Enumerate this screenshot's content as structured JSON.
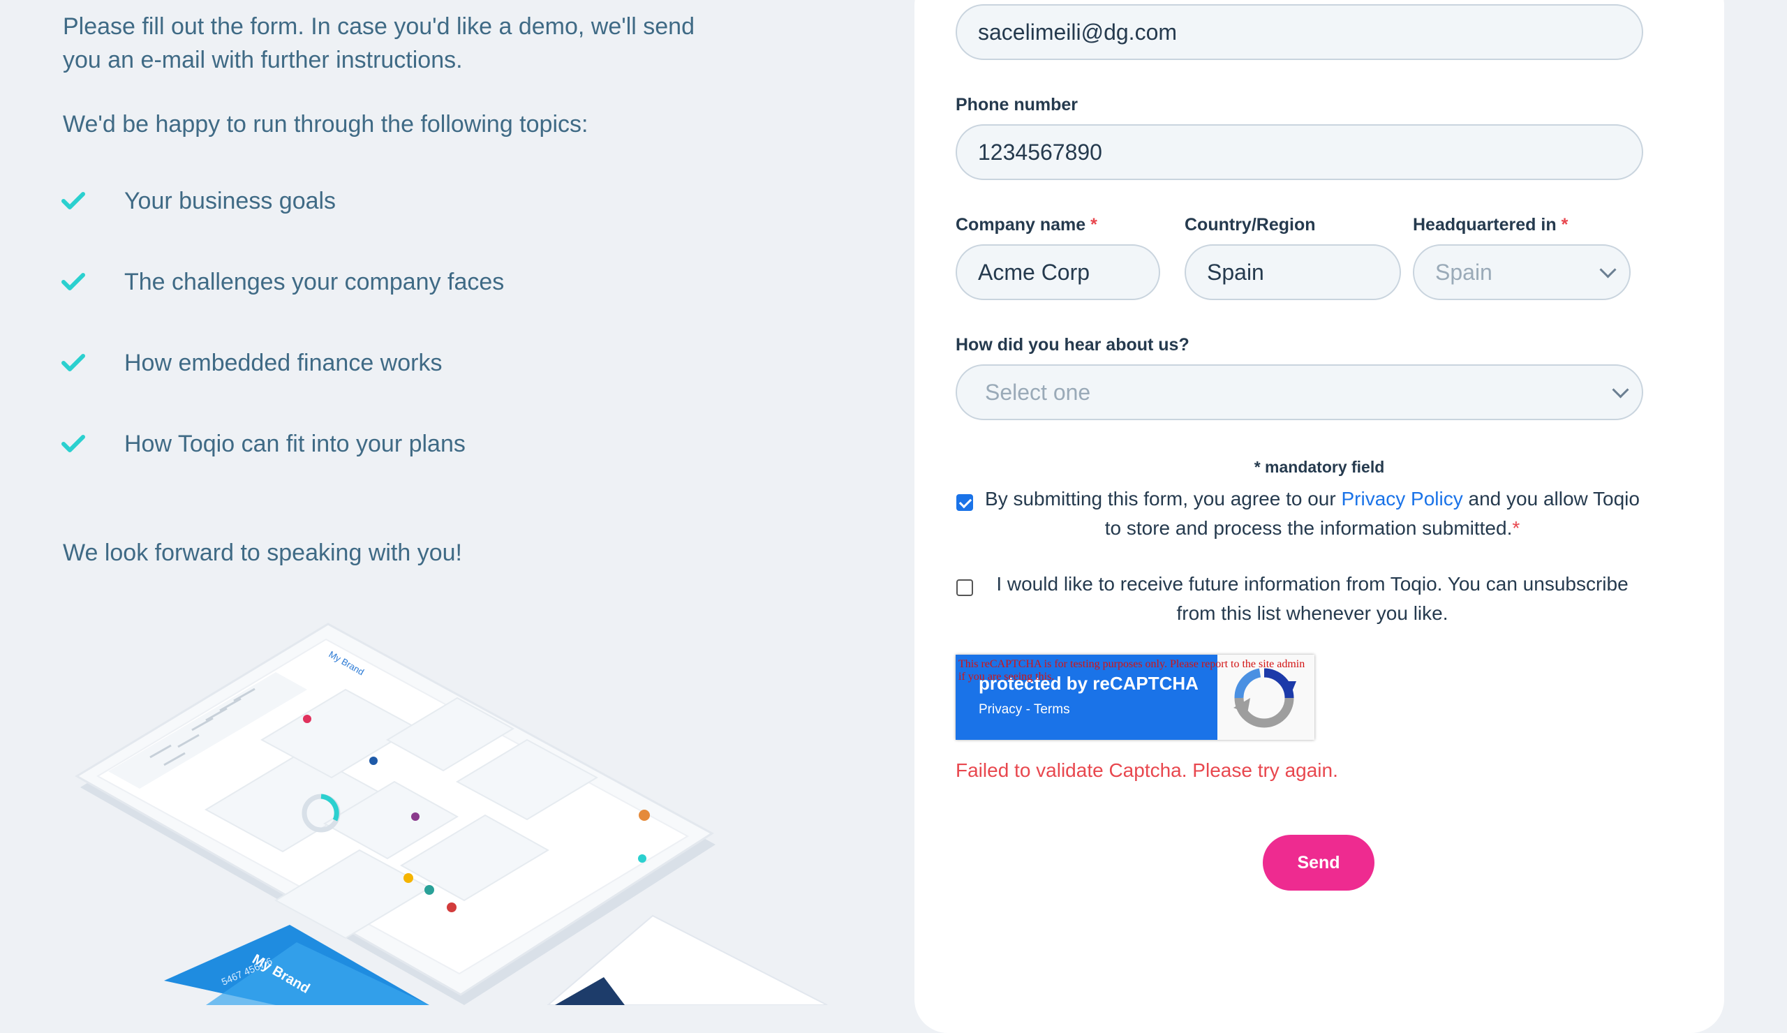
{
  "intro": {
    "paragraph": "Please fill out the form. In case you'd like a demo, we'll send you an e-mail with further instructions.",
    "topics_title": "We'd be happy to run through the following topics:",
    "topics": [
      "Your business goals",
      "The challenges your company faces",
      "How embedded finance works",
      "How Toqio can fit into your plans"
    ],
    "closing": "We look forward to speaking with you!"
  },
  "illustration": {
    "brand": "My Brand",
    "card_number": "5467 4567 6"
  },
  "colors": {
    "accent_teal": "#2bd0cf",
    "text_blue": "#3f6a85",
    "send_pink": "#ee2b90",
    "error_red": "#e8474e",
    "link_blue": "#1a73e8"
  },
  "form": {
    "email": {
      "value": "sacelimeili@dg.com"
    },
    "phone": {
      "label": "Phone number",
      "value": "1234567890"
    },
    "company": {
      "label": "Company name",
      "required_mark": "*",
      "value": "Acme Corp"
    },
    "country": {
      "label": "Country/Region",
      "value": "Spain"
    },
    "hq": {
      "label": "Headquartered in",
      "required_mark": "*",
      "value": "Spain"
    },
    "hear": {
      "label": "How did you hear about us?",
      "value": "Select one"
    },
    "mandatory_note": "* mandatory field",
    "consent": {
      "checked": true,
      "before": "By submitting this form, you agree to our ",
      "link": "Privacy Policy",
      "after": " and you allow Toqio to store and process the information submitted.",
      "required_mark": "*"
    },
    "newsletter": {
      "checked": false,
      "text": "I would like to receive future information from Toqio. You can unsubscribe from this list whenever you like."
    },
    "recaptcha": {
      "warning": "This reCAPTCHA is for testing purposes only. Please report to the site admin if you are seeing this.",
      "protected": "protected by reCAPTCHA",
      "privacy": "Privacy",
      "separator": " - ",
      "terms": "Terms"
    },
    "error": "Failed to validate Captcha. Please try again.",
    "send_label": "Send"
  }
}
